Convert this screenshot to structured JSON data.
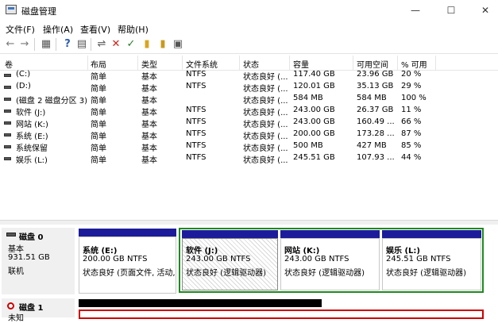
{
  "window": {
    "title": "磁盘管理",
    "minimize": "—",
    "maximize": "☐",
    "close": "✕"
  },
  "menu": [
    "文件(F)",
    "操作(A)",
    "查看(V)",
    "帮助(H)"
  ],
  "toolbar": {
    "back": "←",
    "forward": "→",
    "grid": "▦",
    "help": "?",
    "list": "▤",
    "connect": "⇌",
    "delete": "✕",
    "check": "✓",
    "folder": "▮",
    "props": "▣"
  },
  "columns": [
    "卷",
    "布局",
    "类型",
    "文件系统",
    "状态",
    "容量",
    "可用空间",
    "% 可用"
  ],
  "volumes": [
    {
      "vol": "(C:)",
      "layout": "简单",
      "type": "基本",
      "fs": "NTFS",
      "status": "状态良好 (...",
      "cap": "117.40 GB",
      "free": "23.96 GB",
      "pct": "20 %"
    },
    {
      "vol": "(D:)",
      "layout": "简单",
      "type": "基本",
      "fs": "NTFS",
      "status": "状态良好 (...",
      "cap": "120.01 GB",
      "free": "35.13 GB",
      "pct": "29 %"
    },
    {
      "vol": "(磁盘 2 磁盘分区 3)",
      "layout": "简单",
      "type": "基本",
      "fs": "",
      "status": "状态良好 (...",
      "cap": "584 MB",
      "free": "584 MB",
      "pct": "100 %"
    },
    {
      "vol": "软件 (J:)",
      "layout": "简单",
      "type": "基本",
      "fs": "NTFS",
      "status": "状态良好 (...",
      "cap": "243.00 GB",
      "free": "26.37 GB",
      "pct": "11 %"
    },
    {
      "vol": "网站 (K:)",
      "layout": "简单",
      "type": "基本",
      "fs": "NTFS",
      "status": "状态良好 (...",
      "cap": "243.00 GB",
      "free": "160.49 ...",
      "pct": "66 %"
    },
    {
      "vol": "系统 (E:)",
      "layout": "简单",
      "type": "基本",
      "fs": "NTFS",
      "status": "状态良好 (...",
      "cap": "200.00 GB",
      "free": "173.28 ...",
      "pct": "87 %"
    },
    {
      "vol": "系统保留",
      "layout": "简单",
      "type": "基本",
      "fs": "NTFS",
      "status": "状态良好 (...",
      "cap": "500 MB",
      "free": "427 MB",
      "pct": "85 %"
    },
    {
      "vol": "娱乐 (L:)",
      "layout": "简单",
      "type": "基本",
      "fs": "NTFS",
      "status": "状态良好 (...",
      "cap": "245.51 GB",
      "free": "107.93 ...",
      "pct": "44 %"
    }
  ],
  "disk0": {
    "name": "磁盘 0",
    "type": "基本",
    "size": "931.51 GB",
    "state": "联机",
    "partitions": [
      {
        "name": "系统  (E:)",
        "size": "200.00 GB NTFS",
        "status": "状态良好 (页面文件, 活动,"
      },
      {
        "name": "软件  (J:)",
        "size": "243.00 GB NTFS",
        "status": "状态良好 (逻辑驱动器)"
      },
      {
        "name": "网站  (K:)",
        "size": "243.00 GB NTFS",
        "status": "状态良好 (逻辑驱动器)"
      },
      {
        "name": "娱乐  (L:)",
        "size": "245.51 GB NTFS",
        "status": "状态良好 (逻辑驱动器)"
      }
    ]
  },
  "disk1": {
    "name": "磁盘 1",
    "type": "未知"
  },
  "colors": {
    "primary_bar": "#1c1c9a",
    "extended_border": "#1f8a1f",
    "unalloc_bar": "#000000",
    "disk1_border": "#cc0000"
  }
}
